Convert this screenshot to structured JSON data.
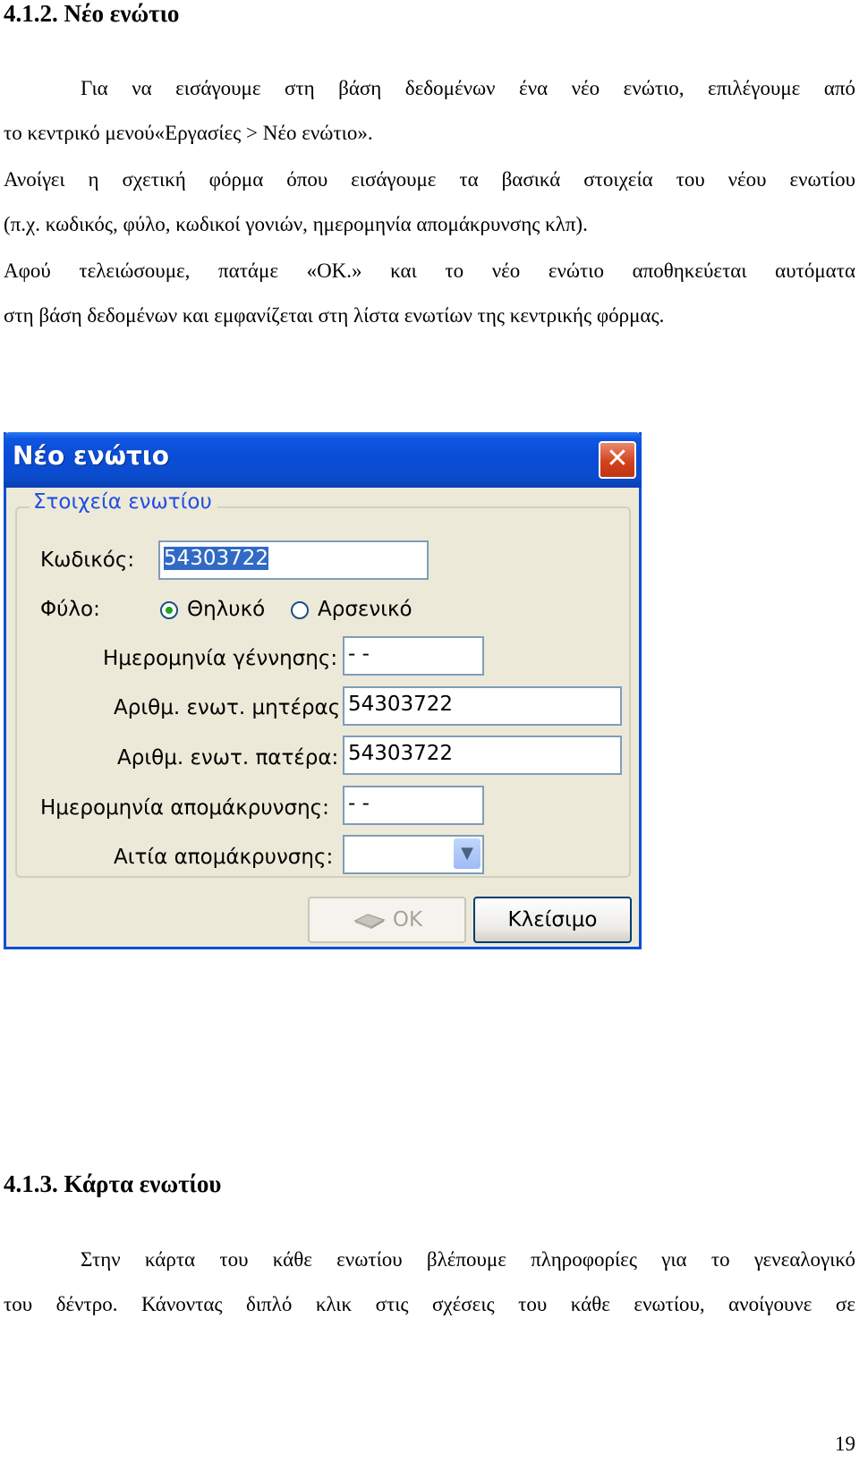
{
  "section1": {
    "heading": "4.1.2. Νέο ενώτιο",
    "lines": [
      "Για να εισάγουμε στη βάση δεδομένων ένα νέο ενώτιο, επιλέγουμε από",
      "το κεντρικό μενού«Εργασίες > Νέο ενώτιο».",
      "Ανοίγει η σχετική φόρμα όπου εισάγουμε τα βασικά στοιχεία του νέου ενωτίου",
      "(π.χ. κωδικός, φύλο, κωδικοί γονιών, ημερομηνία απομάκρυνσης κλπ).",
      "Αφού τελειώσουμε, πατάμε «OK.» και το νέο ενώτιο αποθηκεύεται αυτόματα",
      "στη βάση δεδομένων και εμφανίζεται στη λίστα ενωτίων της κεντρικής φόρμας."
    ]
  },
  "dialog": {
    "title": "Νέο ενώτιο",
    "close_symbol": "✕",
    "group_title": "Στοιχεία ενωτίου",
    "code_label": "Κωδικός:",
    "code_value": "54303722",
    "sex_label": "Φύλο:",
    "sex_options": [
      "Θηλυκό",
      "Αρσενικό"
    ],
    "sex_selected": "Θηλυκό",
    "birth_label": "Ημερομηνία γέννησης:",
    "birth_value": "- -",
    "mother_label": "Αριθμ. ενωτ. μητέρας:",
    "mother_value": "54303722",
    "father_label": "Αριθμ. ενωτ. πατέρα:",
    "father_value": "54303722",
    "removal_date_label": "Ημερομηνία απομάκρυνσης:",
    "removal_date_value": "- -",
    "removal_reason_label": "Αιτία απομάκρυνσης:",
    "removal_reason_value": "",
    "ok_label": "OK",
    "close_label": "Κλείσιμο",
    "colors": {
      "titlebar": "#0a4cd6",
      "group_title": "#1f4fe0",
      "dialog_bg": "#ece9d8"
    }
  },
  "section2": {
    "heading": "4.1.3. Κάρτα ενωτίου",
    "lines": [
      "Στην κάρτα του κάθε ενωτίου βλέπουμε πληροφορίες για το γενεαλογικό",
      "του δέντρο. Κάνοντας διπλό κλικ στις σχέσεις του κάθε ενωτίου, ανοίγουνε σε"
    ]
  },
  "page_number": "19"
}
